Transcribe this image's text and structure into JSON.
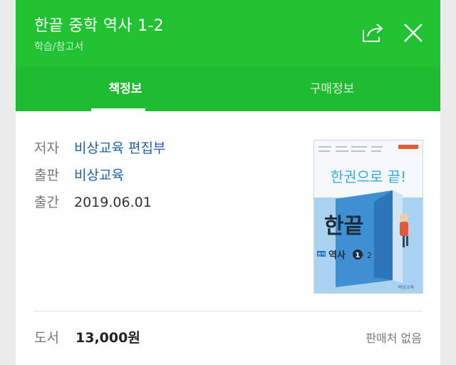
{
  "header": {
    "title": "한끝 중학 역사 1-2",
    "category": "학습/참고서"
  },
  "tabs": [
    {
      "label": "책정보",
      "active": true
    },
    {
      "label": "구매정보",
      "active": false
    }
  ],
  "book_info": [
    {
      "label": "저자",
      "value": "비상교육 편집부",
      "is_link": true
    },
    {
      "label": "출판",
      "value": "비상교육",
      "is_link": true
    },
    {
      "label": "출간",
      "value": "2019.06.01",
      "is_link": false
    }
  ],
  "cover": {
    "slogan": "한권으로 끝!",
    "brand": "한끝",
    "grade": "중학",
    "subject": "역사",
    "volume_main": "1",
    "volume_sub": "2",
    "publisher": "비상교육"
  },
  "price": {
    "label": "도서",
    "value": "13,000원",
    "seller_status": "판매처 없음"
  },
  "icons": {
    "share": "share-icon",
    "close": "close-icon"
  },
  "colors": {
    "header_green": "#20c232",
    "tab_green": "#1fbb30",
    "link_blue": "#1f5fa8"
  }
}
